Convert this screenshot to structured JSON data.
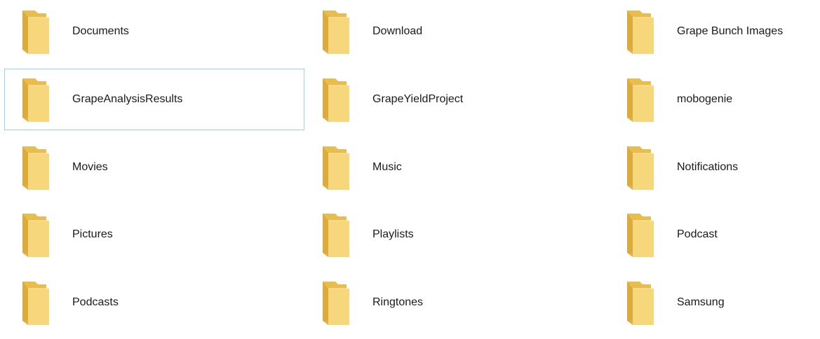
{
  "folder_view": {
    "selected_index": 3,
    "items": [
      {
        "label": "Documents",
        "icon": "folder-icon"
      },
      {
        "label": "Download",
        "icon": "folder-icon"
      },
      {
        "label": "Grape Bunch Images",
        "icon": "folder-icon"
      },
      {
        "label": "GrapeAnalysisResults",
        "icon": "folder-icon"
      },
      {
        "label": "GrapeYieldProject",
        "icon": "folder-icon"
      },
      {
        "label": "mobogenie",
        "icon": "folder-icon"
      },
      {
        "label": "Movies",
        "icon": "folder-icon"
      },
      {
        "label": "Music",
        "icon": "folder-icon"
      },
      {
        "label": "Notifications",
        "icon": "folder-icon"
      },
      {
        "label": "Pictures",
        "icon": "folder-icon"
      },
      {
        "label": "Playlists",
        "icon": "folder-icon"
      },
      {
        "label": "Podcast",
        "icon": "folder-icon"
      },
      {
        "label": "Podcasts",
        "icon": "folder-icon"
      },
      {
        "label": "Ringtones",
        "icon": "folder-icon"
      },
      {
        "label": "Samsung",
        "icon": "folder-icon"
      }
    ]
  },
  "colors": {
    "folder_back": "#e8bd4e",
    "folder_front": "#f7d77b",
    "folder_shadow": "#d9a93a",
    "selection_border": "#99d1ff"
  }
}
